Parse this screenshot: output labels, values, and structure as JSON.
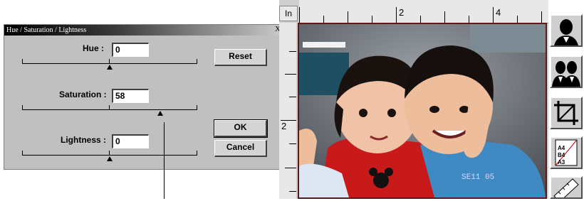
{
  "dialog": {
    "title": "Hue / Saturation / Lightness",
    "close_glyph": "X",
    "hue": {
      "label": "Hue :",
      "value": "0",
      "level": 0.5
    },
    "saturation": {
      "label": "Saturation :",
      "value": "58",
      "level": 0.79
    },
    "lightness": {
      "label": "Lightness :",
      "value": "0",
      "level": 0.5
    },
    "buttons": {
      "reset": "Reset",
      "ok": "OK",
      "cancel": "Cancel"
    }
  },
  "ruler": {
    "unit": "In",
    "top_labels": [
      "2",
      "4"
    ],
    "left_labels": [
      "2"
    ]
  },
  "photo": {
    "stamp": "SE11 05"
  },
  "toolbar": [
    "single-portrait-icon",
    "double-portrait-icon",
    "crop-icon",
    "paper-size-icon",
    "ruler-icon"
  ],
  "toolbar_paper": {
    "a4": "A4",
    "b4": "B4",
    "a3": "A3"
  }
}
